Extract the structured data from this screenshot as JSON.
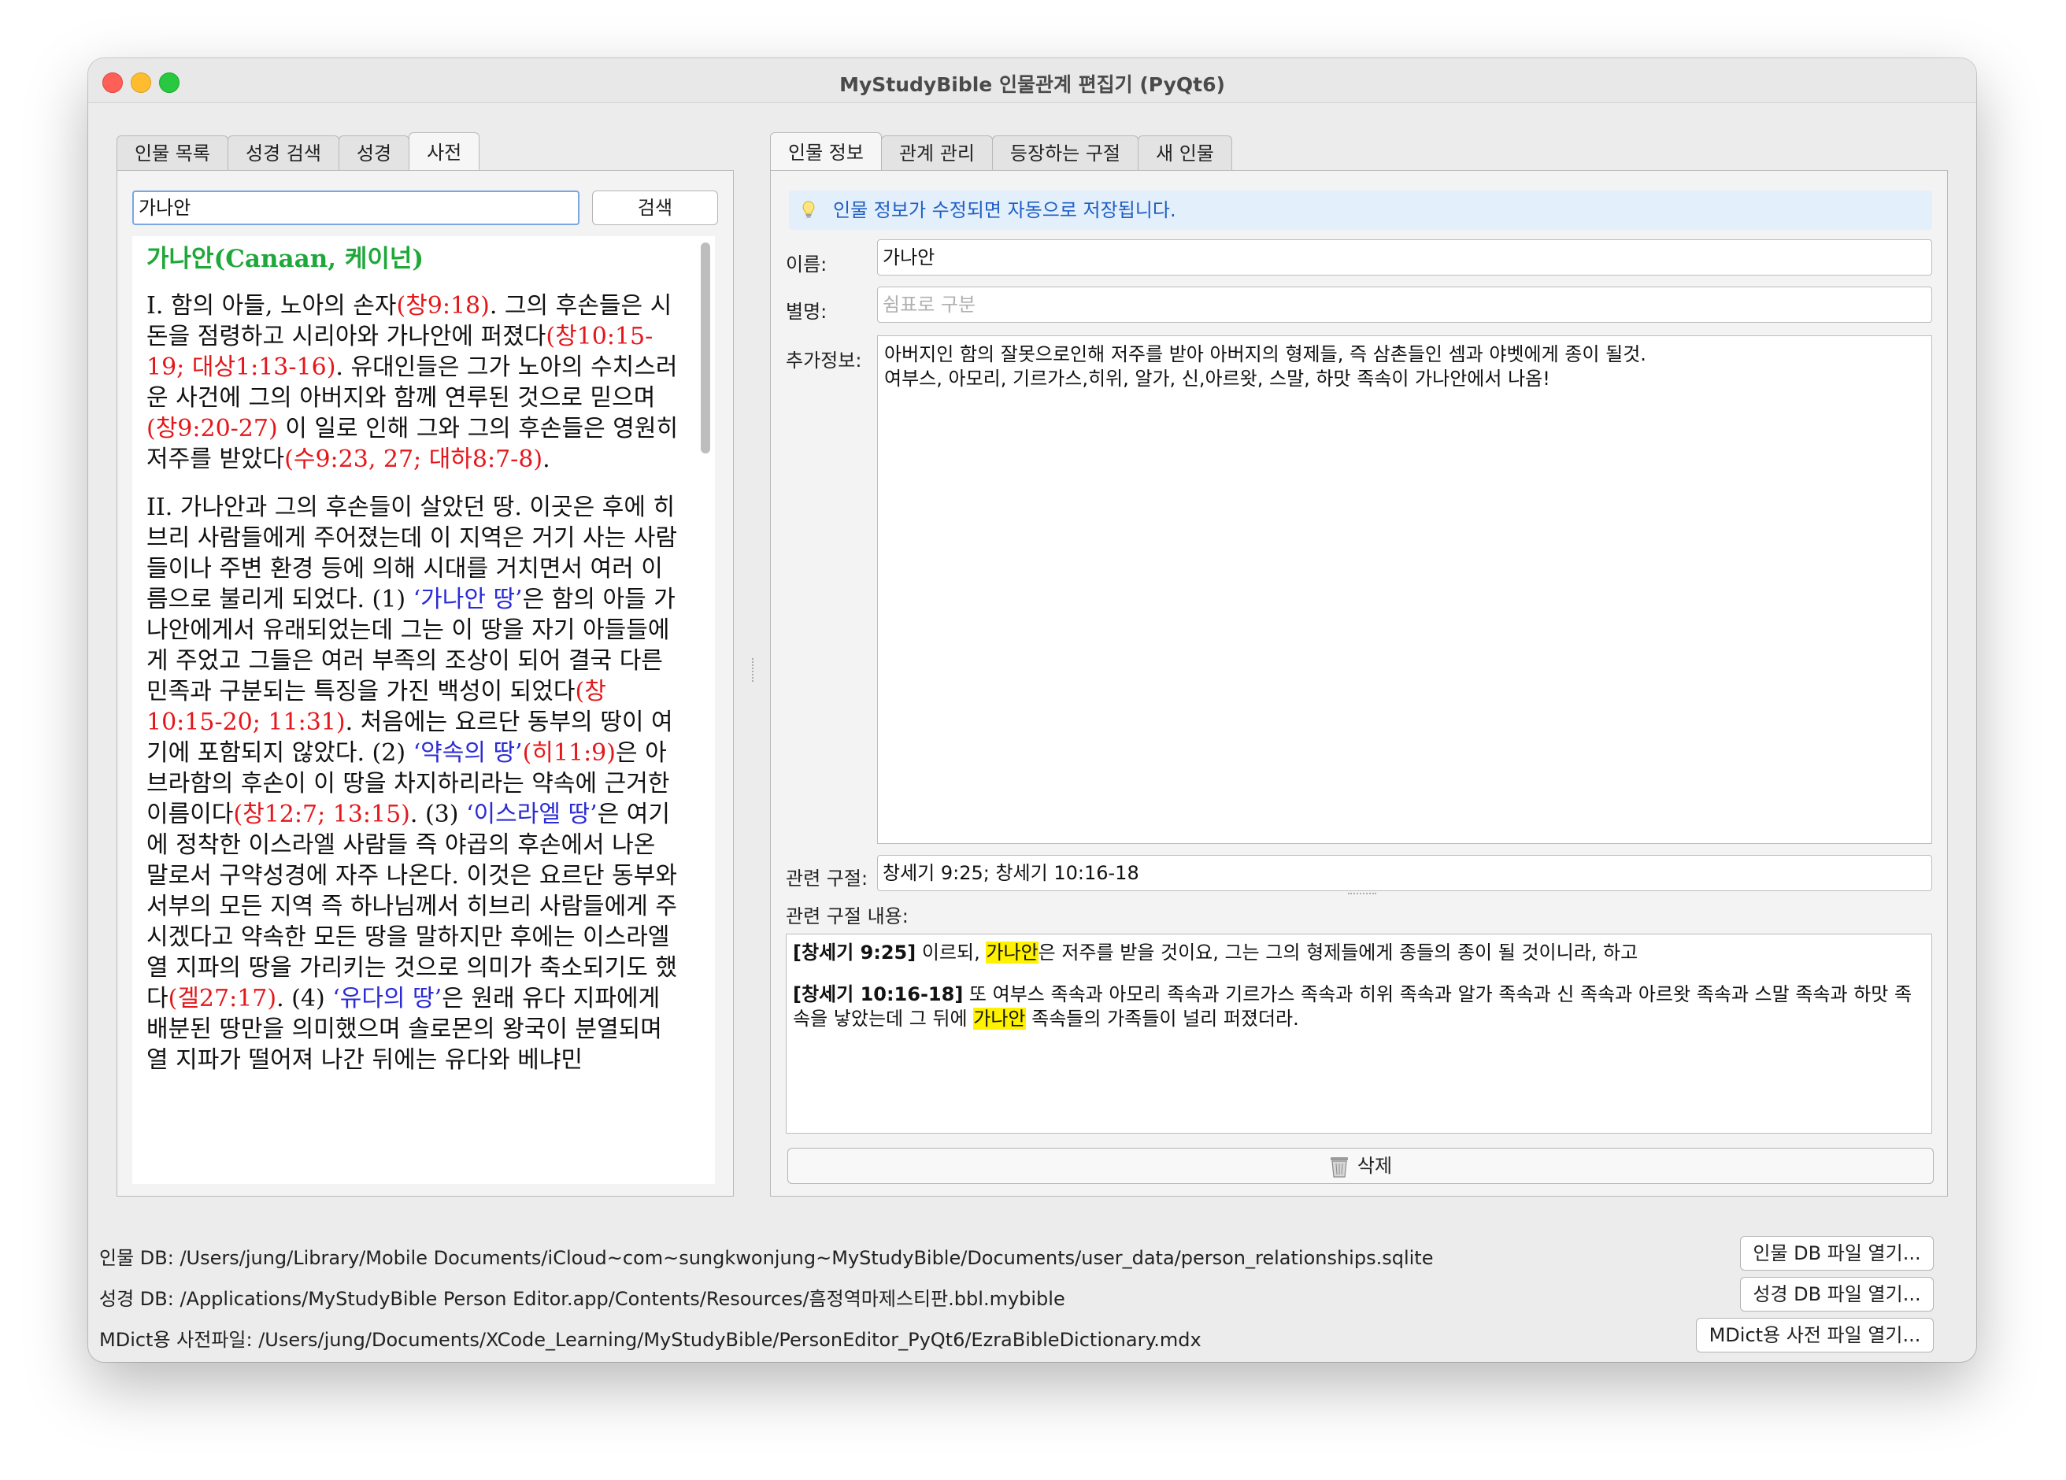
{
  "window": {
    "title": "MyStudyBible 인물관계 편집기 (PyQt6)"
  },
  "left_tabs": [
    "인물 목록",
    "성경 검색",
    "성경",
    "사전"
  ],
  "right_tabs": [
    "인물 정보",
    "관계 관리",
    "등장하는 구절",
    "새 인물"
  ],
  "dictionary": {
    "search_value": "가나안",
    "search_button": "검색",
    "title": "가나안(Canaan, 케이넌)",
    "p1": [
      {
        "t": "I. 함의 아들, 노아의 손자"
      },
      {
        "t": "(창9:18)",
        "c": "ref"
      },
      {
        "t": ". 그의 후손들은 시돈을 점령하고 시리아와 가나안에 퍼졌다"
      },
      {
        "t": "(창10:15-19; 대상1:13-16)",
        "c": "ref"
      },
      {
        "t": ". 유대인들은 그가 노아의 수치스러운 사건에 그의 아버지와 함께 연루된 것으로 믿으며"
      },
      {
        "t": "(창9:20-27)",
        "c": "ref"
      },
      {
        "t": " 이 일로 인해 그와 그의 후손들은 영원히 저주를 받았다"
      },
      {
        "t": "(수9:23, 27; 대하8:7-8)",
        "c": "ref"
      },
      {
        "t": "."
      }
    ],
    "p2": [
      {
        "t": "II. 가나안과 그의 후손들이 살았던 땅. 이곳은 후에 히브리 사람들에게 주어졌는데 이 지역은 거기 사는 사람들이나 주변 환경 등에 의해 시대를 거치면서 여러 이름으로 불리게 되었다. (1) "
      },
      {
        "t": "‘가나안 땅’",
        "c": "blue"
      },
      {
        "t": "은 함의 아들 가나안에게서 유래되었는데 그는 이 땅을 자기 아들들에게 주었고 그들은 여러 부족의 조상이 되어 결국 다른 민족과 구분되는 특징을 가진 백성이 되었다"
      },
      {
        "t": "(창10:15-20; 11:31)",
        "c": "ref"
      },
      {
        "t": ". 처음에는 요르단 동부의 땅이 여기에 포함되지 않았다. (2) "
      },
      {
        "t": "‘약속의 땅’",
        "c": "blue"
      },
      {
        "t": "(히11:9)",
        "c": "ref"
      },
      {
        "t": "은 아브라함의 후손이 이 땅을 차지하리라는 약속에 근거한 이름이다"
      },
      {
        "t": "(창12:7; 13:15)",
        "c": "ref"
      },
      {
        "t": ". (3) "
      },
      {
        "t": "‘이스라엘 땅’",
        "c": "blue"
      },
      {
        "t": "은 여기에 정착한 이스라엘 사람들 즉 야곱의 후손에서 나온 말로서 구약성경에 자주 나온다. 이것은 요르단 동부와 서부의 모든 지역 즉 하나님께서 히브리 사람들에게 주시겠다고 약속한 모든 땅을 말하지만 후에는 이스라엘 열 지파의 땅을 가리키는 것으로 의미가 축소되기도 했다"
      },
      {
        "t": "(겔27:17)",
        "c": "ref"
      },
      {
        "t": ". (4) "
      },
      {
        "t": "‘유다의 땅’",
        "c": "blue"
      },
      {
        "t": "은 원래 유다 지파에게 배분된 땅만을 의미했으며 솔로몬의 왕국이 분열되며 열 지파가 떨어져 나간 뒤에는 유다와 베냐민"
      }
    ]
  },
  "person": {
    "info_message": "인물 정보가 수정되면 자동으로 저장됩니다.",
    "name_label": "이름:",
    "name_value": "가나안",
    "alias_label": "별명:",
    "alias_placeholder": "쉼표로 구분",
    "extra_label": "추가정보:",
    "extra_line1": "아버지인 함의 잘못으로인해 저주를 받아 아버지의 형제들, 즉 삼촌들인 셈과 야벳에게 종이 될것.",
    "extra_line2": "여부스, 아모리, 기르가스,히위, 알가, 신,아르왓, 스말, 하맛 족속이 가나안에서 나옴!",
    "verses_label": "관련 구절:",
    "verses_value": "창세기 9:25; 창세기 10:16-18",
    "verse_content_label": "관련 구절 내용:",
    "verse1": {
      "ref": "[창세기 9:25]",
      "pre": " 이르되, ",
      "hl": "가나안",
      "post": "은 저주를 받을 것이요, 그는 그의 형제들에게 종들의 종이 될 것이니라, 하고"
    },
    "verse2": {
      "ref": "[창세기 10:16-18]",
      "pre": " 또 여부스 족속과 아모리 족속과 기르가스 족속과 히위 족속과 알가 족속과 신 족속과 아르왓 족속과 스말 족속과 하맛 족속을 낳았는데 그 뒤에 ",
      "hl": "가나안",
      "post": " 족속들의 가족들이 널리 퍼졌더라."
    },
    "delete_button": "삭제"
  },
  "footer": {
    "person_db": "인물 DB: /Users/jung/Library/Mobile Documents/iCloud~com~sungkwonjung~MyStudyBible/Documents/user_data/person_relationships.sqlite",
    "bible_db": "성경 DB: /Applications/MyStudyBible Person Editor.app/Contents/Resources/흠정역마제스티판.bbl.mybible",
    "mdict": "MDict용 사전파일: /Users/jung/Documents/XCode_Learning/MyStudyBible/PersonEditor_PyQt6/EzraBibleDictionary.mdx",
    "open_person_db": "인물 DB 파일 열기...",
    "open_bible_db": "성경 DB 파일 열기...",
    "open_mdict": "MDict용 사전 파일 열기..."
  },
  "colors": {
    "accent_blue": "#1f5fc4",
    "ref_red": "#e4171b",
    "term_blue": "#2b2bd6",
    "title_green": "#1fa83a",
    "highlight": "#fff200"
  },
  "icons": [
    "lightbulb-icon",
    "trash-icon"
  ]
}
